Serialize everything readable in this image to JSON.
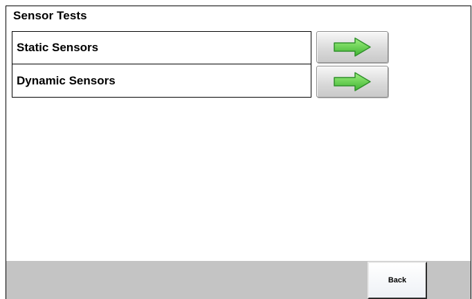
{
  "header": {
    "title": "Sensor Tests"
  },
  "menu": {
    "items": [
      {
        "label": "Static Sensors",
        "icon": "arrow-right-icon"
      },
      {
        "label": "Dynamic Sensors",
        "icon": "arrow-right-icon"
      }
    ]
  },
  "footer": {
    "back_label": "Back"
  },
  "colors": {
    "arrow_fill": "#5fd04a",
    "arrow_stroke": "#2f8f2a",
    "footer_bar": "#c4c4c4"
  }
}
